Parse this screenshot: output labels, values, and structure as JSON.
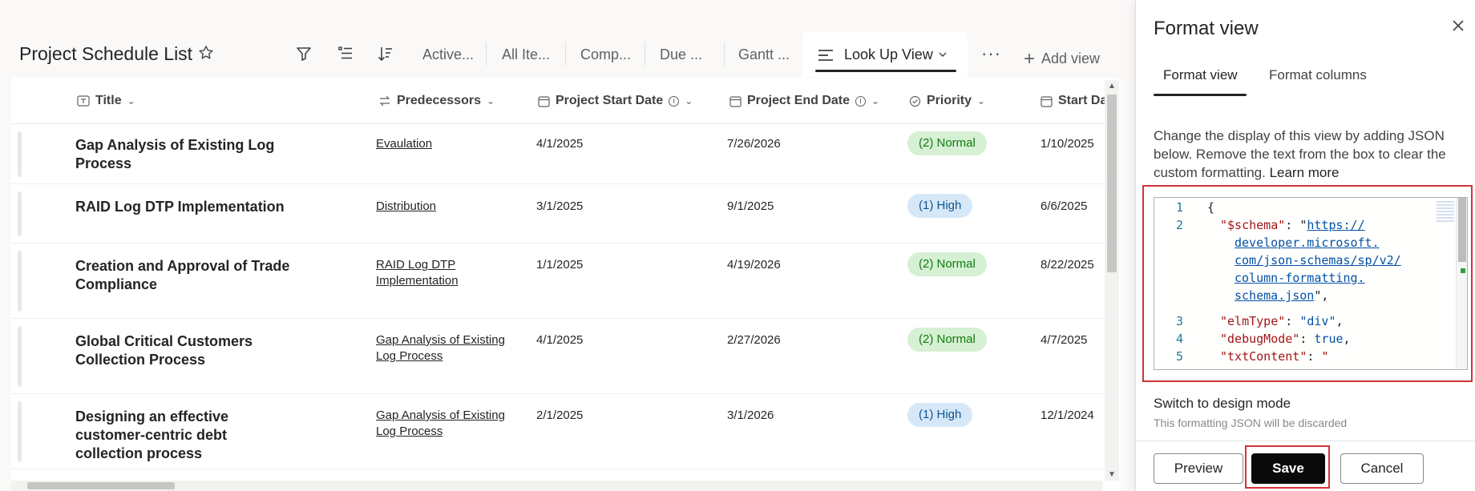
{
  "list": {
    "title": "Project Schedule List",
    "tabs": [
      "Active...",
      "All Ite...",
      "Comp...",
      "Due ...",
      "Gantt ..."
    ],
    "active_tab": "Look Up View",
    "add_view": "Add view",
    "columns": {
      "title": "Title",
      "predecessors": "Predecessors",
      "project_start": "Project Start Date",
      "project_end": "Project End Date",
      "priority": "Priority",
      "start": "Start Da"
    },
    "rows": [
      {
        "title": "Gap Analysis of Existing Log Process",
        "predecessors": "Evaulation",
        "project_start": "4/1/2025",
        "project_end": "7/26/2026",
        "priority": "(2) Normal",
        "start": "1/10/2025"
      },
      {
        "title": "RAID Log DTP Implementation",
        "predecessors": "Distribution",
        "project_start": "3/1/2025",
        "project_end": "9/1/2025",
        "priority": "(1) High",
        "start": "6/6/2025"
      },
      {
        "title": "Creation and Approval of Trade Compliance",
        "predecessors": "RAID Log DTP Implementation",
        "project_start": "1/1/2025",
        "project_end": "4/19/2026",
        "priority": "(2) Normal",
        "start": "8/22/2025"
      },
      {
        "title": "Global Critical Customers Collection Process",
        "predecessors": "Gap Analysis of Existing Log Process",
        "project_start": "4/1/2025",
        "project_end": "2/27/2026",
        "priority": "(2) Normal",
        "start": "4/7/2025"
      },
      {
        "title": "Designing an effective customer-centric debt collection process",
        "predecessors": "Gap Analysis of Existing Log Process",
        "project_start": "2/1/2025",
        "project_end": "3/1/2026",
        "priority": "(1) High",
        "start": "12/1/2024"
      }
    ]
  },
  "panel": {
    "title": "Format view",
    "tabs": [
      "Format view",
      "Format columns"
    ],
    "description": "Change the display of this view by adding JSON below. Remove the text from the box to clear the custom formatting.",
    "learn_more": "Learn more",
    "code": {
      "line_numbers": [
        "1",
        "2",
        "3",
        "4",
        "5"
      ],
      "open_brace": "{",
      "schema_key": "\"$schema\"",
      "schema_url_lines": [
        "https://",
        "developer.microsoft.",
        "com/json-schemas/sp/v2/",
        "column-formatting.",
        "schema.json"
      ],
      "elmtype_key": "\"elmType\"",
      "elmtype_val": "\"div\"",
      "debug_key": "\"debugMode\"",
      "debug_val": "true",
      "txt_key": "\"txtContent\"",
      "txt_val": "\""
    },
    "switch_label": "Switch to design mode",
    "discard_note": "This formatting JSON will be discarded",
    "buttons": {
      "preview": "Preview",
      "save": "Save",
      "cancel": "Cancel"
    }
  },
  "colors": {
    "highlight_red": "#d13438",
    "normal_pill": "#d5f0d2",
    "high_pill": "#d6e8f8",
    "save_bg": "#0a0a0a"
  }
}
